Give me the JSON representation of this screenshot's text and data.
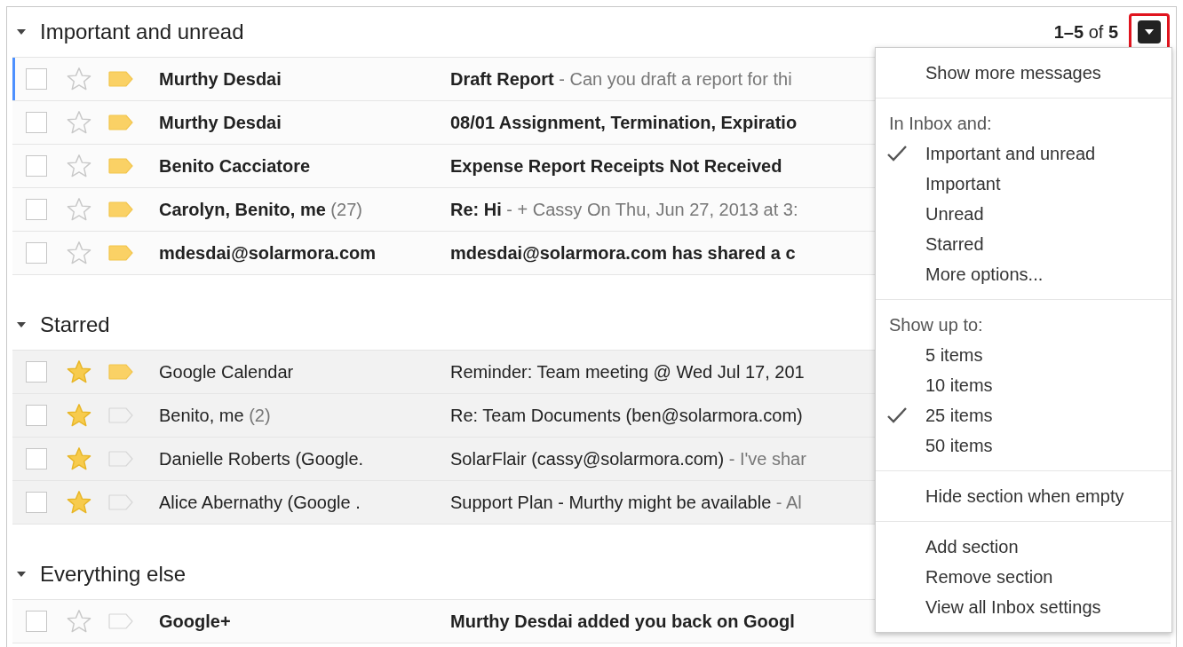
{
  "sections": [
    {
      "title": "Important and unread",
      "expanded": true,
      "pager": "**1–5** of **5**",
      "menu_button": {
        "highlighted": true
      },
      "rows": [
        {
          "sender": "Murthy Desdai",
          "subject": "Draft Report",
          "snippet": " - Can you draft a report for thi",
          "unread": true,
          "starred": false,
          "important": true,
          "focused": true
        },
        {
          "sender": "Murthy Desdai",
          "subject": "08/01 Assignment, Termination, Expiratio",
          "unread": true,
          "starred": false,
          "important": true,
          "focused": false
        },
        {
          "sender": "Benito Cacciatore",
          "subject": "Expense Report Receipts Not Received",
          "unread": true,
          "starred": false,
          "important": true,
          "focused": false
        },
        {
          "sender": "Carolyn, Benito, me",
          "count": " (27)",
          "subject": "Re: Hi",
          "snippet": " - + Cassy On Thu, Jun 27, 2013 at 3:",
          "unread": true,
          "starred": false,
          "important": true,
          "focused": false
        },
        {
          "sender": "mdesdai@solarmora.com",
          "subject": "mdesdai@solarmora.com has shared a c",
          "unread": true,
          "starred": false,
          "important": true,
          "focused": false
        }
      ]
    },
    {
      "title": "Starred",
      "expanded": true,
      "rows": [
        {
          "sender": "Google Calendar",
          "subject": "Reminder: Team meeting @ Wed Jul 17, 201",
          "unread": false,
          "starred": true,
          "important": true,
          "focused": false
        },
        {
          "sender": "Benito, me",
          "count": " (2)",
          "subject": "Re: Team Documents (ben@solarmora.com)",
          "unread": false,
          "starred": true,
          "important": false,
          "focused": false
        },
        {
          "sender": "Danielle Roberts (Google.",
          "subject": "SolarFlair (cassy@solarmora.com)",
          "snippet": " - I've shar",
          "unread": false,
          "starred": true,
          "important": false,
          "focused": false
        },
        {
          "sender": "Alice Abernathy (Google .",
          "subject": "Support Plan - Murthy might be available",
          "snippet": " - Al",
          "unread": false,
          "starred": true,
          "important": false,
          "focused": false
        }
      ]
    },
    {
      "title": "Everything else",
      "expanded": true,
      "rows": [
        {
          "sender": "Google+",
          "subject": "Murthy Desdai added you back on Googl",
          "unread": true,
          "starred": false,
          "important": false,
          "focused": false
        }
      ]
    }
  ],
  "menu": {
    "groups": [
      {
        "items": [
          {
            "label": "Show more messages"
          }
        ]
      },
      {
        "heading": "In Inbox and:",
        "items": [
          {
            "label": "Important and unread",
            "checked": true
          },
          {
            "label": "Important",
            "checked": false
          },
          {
            "label": "Unread",
            "checked": false
          },
          {
            "label": "Starred",
            "checked": false
          },
          {
            "label": "More options...",
            "checked": false
          }
        ]
      },
      {
        "heading": "Show up to:",
        "items": [
          {
            "label": "5 items",
            "checked": false
          },
          {
            "label": "10 items",
            "checked": false
          },
          {
            "label": "25 items",
            "checked": true
          },
          {
            "label": "50 items",
            "checked": false
          }
        ]
      },
      {
        "items": [
          {
            "label": "Hide section when empty"
          }
        ]
      },
      {
        "items": [
          {
            "label": "Add section"
          },
          {
            "label": "Remove section"
          },
          {
            "label": "View all Inbox settings"
          }
        ]
      }
    ]
  }
}
